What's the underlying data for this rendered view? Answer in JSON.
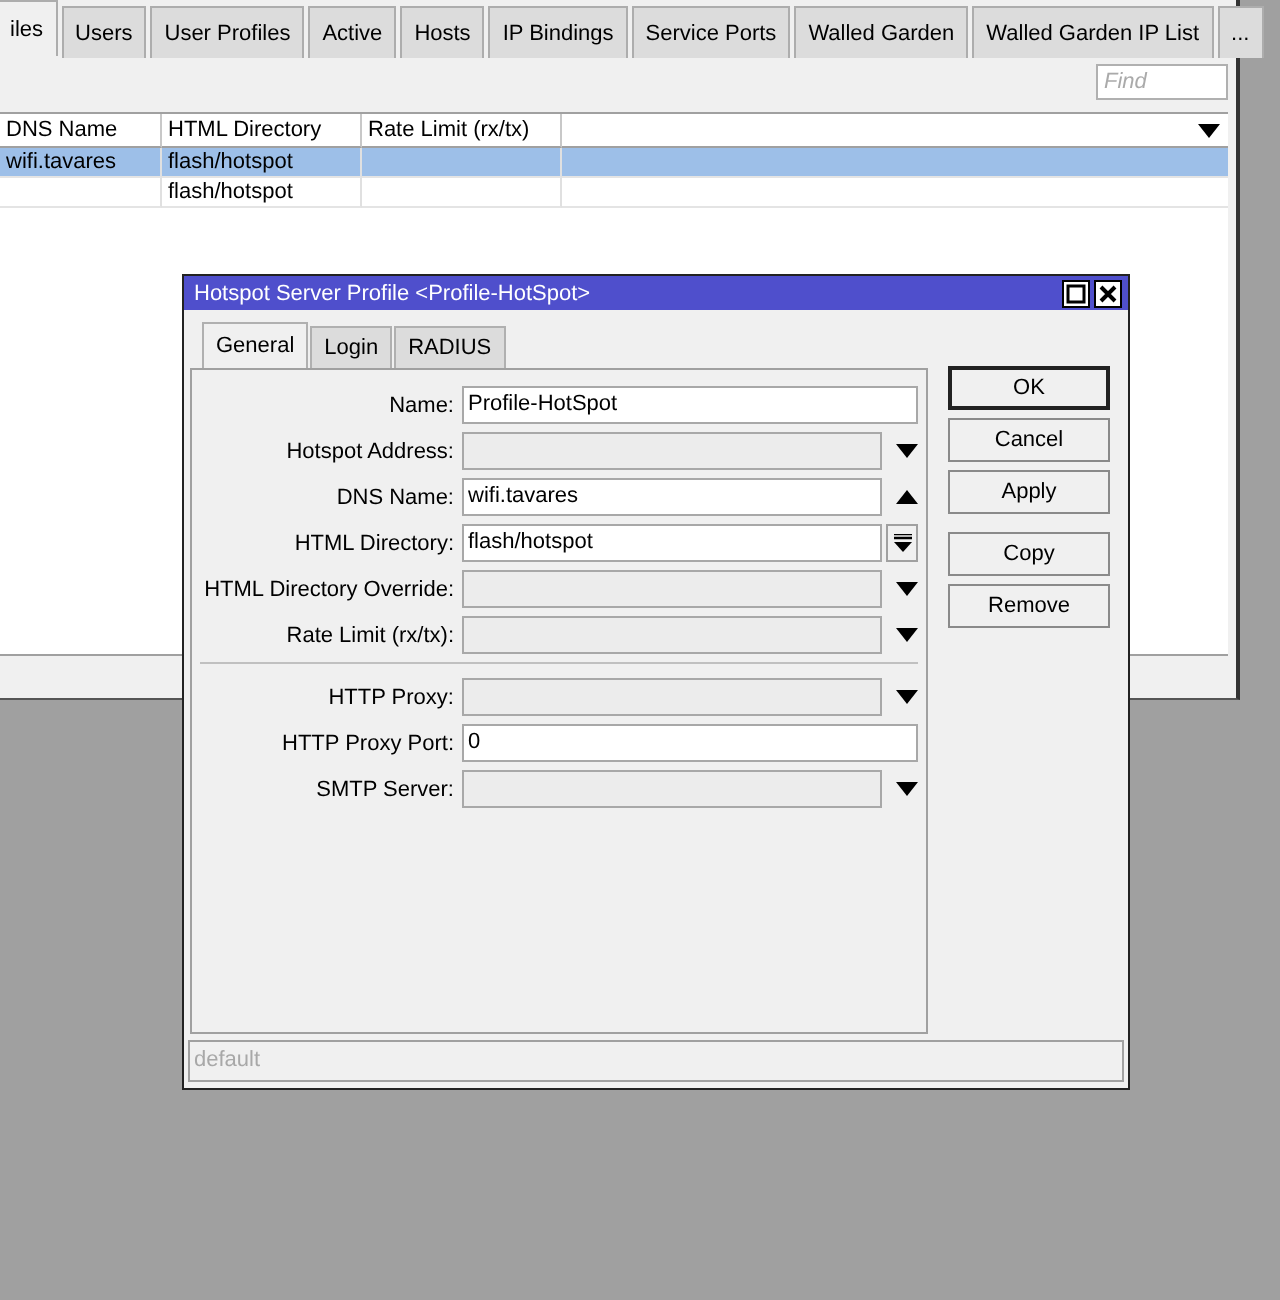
{
  "main_window": {
    "tabs": [
      {
        "label": "iles",
        "selected": true
      },
      {
        "label": "Users",
        "selected": false
      },
      {
        "label": "User Profiles",
        "selected": false
      },
      {
        "label": "Active",
        "selected": false
      },
      {
        "label": "Hosts",
        "selected": false
      },
      {
        "label": "IP Bindings",
        "selected": false
      },
      {
        "label": "Service Ports",
        "selected": false
      },
      {
        "label": "Walled Garden",
        "selected": false
      },
      {
        "label": "Walled Garden IP List",
        "selected": false
      },
      {
        "label": "...",
        "selected": false
      }
    ],
    "search": {
      "placeholder": "Find"
    },
    "table": {
      "columns": [
        "DNS Name",
        "HTML Directory",
        "Rate Limit (rx/tx)"
      ],
      "rows": [
        {
          "cells": [
            "wifi.tavares",
            "flash/hotspot",
            ""
          ],
          "selected": true
        },
        {
          "cells": [
            "",
            "flash/hotspot",
            ""
          ],
          "selected": false
        }
      ]
    }
  },
  "dialog": {
    "title": "Hotspot Server Profile <Profile-HotSpot>",
    "tabs": [
      {
        "label": "General",
        "selected": true
      },
      {
        "label": "Login",
        "selected": false
      },
      {
        "label": "RADIUS",
        "selected": false
      }
    ],
    "field_groups": [
      [
        {
          "label": "Name:",
          "kind": "text",
          "value": "Profile-HotSpot"
        },
        {
          "label": "Hotspot Address:",
          "kind": "dropdown"
        },
        {
          "label": "DNS Name:",
          "kind": "collapse",
          "value": "wifi.tavares"
        },
        {
          "label": "HTML Directory:",
          "kind": "remove",
          "value": "flash/hotspot"
        },
        {
          "label": "HTML Directory Override:",
          "kind": "dropdown"
        },
        {
          "label": "Rate Limit (rx/tx):",
          "kind": "dropdown"
        }
      ],
      [
        {
          "label": "HTTP Proxy:",
          "kind": "dropdown"
        },
        {
          "label": "HTTP Proxy Port:",
          "kind": "text",
          "value": "0"
        },
        {
          "label": "SMTP Server:",
          "kind": "dropdown"
        }
      ]
    ],
    "buttons": [
      {
        "label": "OK",
        "default": true
      },
      {
        "label": "Cancel",
        "default": false
      },
      {
        "label": "Apply",
        "default": false
      },
      {
        "label": "Copy",
        "default": false
      },
      {
        "label": "Remove",
        "default": false
      }
    ],
    "status_bar": "default"
  }
}
